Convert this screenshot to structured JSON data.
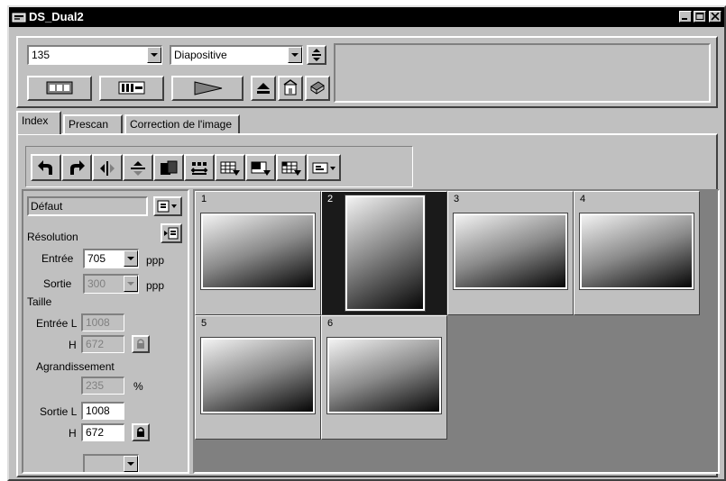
{
  "window": {
    "title": "DS_Dual2"
  },
  "top": {
    "format_value": "135",
    "film_type_value": "Diapositive"
  },
  "tabs": [
    {
      "label": "Index"
    },
    {
      "label": "Prescan"
    },
    {
      "label": "Correction de l'image"
    }
  ],
  "left_panel": {
    "preset_label": "Défaut",
    "resolution_label": "Résolution",
    "input_label": "Entrée",
    "input_value": "705",
    "input_unit": "ppp",
    "output_label": "Sortie",
    "output_value": "300",
    "output_unit": "ppp",
    "size_label": "Taille",
    "size_input_w_label": "Entrée L",
    "size_input_w_value": "1008",
    "size_input_h_label": "H",
    "size_input_h_value": "672",
    "enlarge_label": "Agrandissement",
    "enlarge_value": "235",
    "enlarge_unit": "%",
    "size_output_w_label": "Sortie L",
    "size_output_w_value": "1008",
    "size_output_h_label": "H",
    "size_output_h_value": "672"
  },
  "thumbnails": [
    {
      "number": "1",
      "selected": false,
      "orientation": "landscape"
    },
    {
      "number": "2",
      "selected": true,
      "orientation": "portrait"
    },
    {
      "number": "3",
      "selected": false,
      "orientation": "landscape"
    },
    {
      "number": "4",
      "selected": false,
      "orientation": "landscape"
    },
    {
      "number": "5",
      "selected": false,
      "orientation": "landscape"
    },
    {
      "number": "6",
      "selected": false,
      "orientation": "landscape"
    }
  ],
  "icons": {
    "scan_toolbar": [
      "index-scan-icon",
      "prescan-icon",
      "scan-icon",
      "eject-icon",
      "preferences-icon",
      "help-icon"
    ],
    "image_toolbar": [
      "rotate-left-icon",
      "rotate-right-icon",
      "flip-horizontal-icon",
      "flip-vertical-icon",
      "invert-icon",
      "swap-icon",
      "select-all-icon",
      "select-some-icon",
      "select-one-icon",
      "view-menu-icon"
    ]
  }
}
